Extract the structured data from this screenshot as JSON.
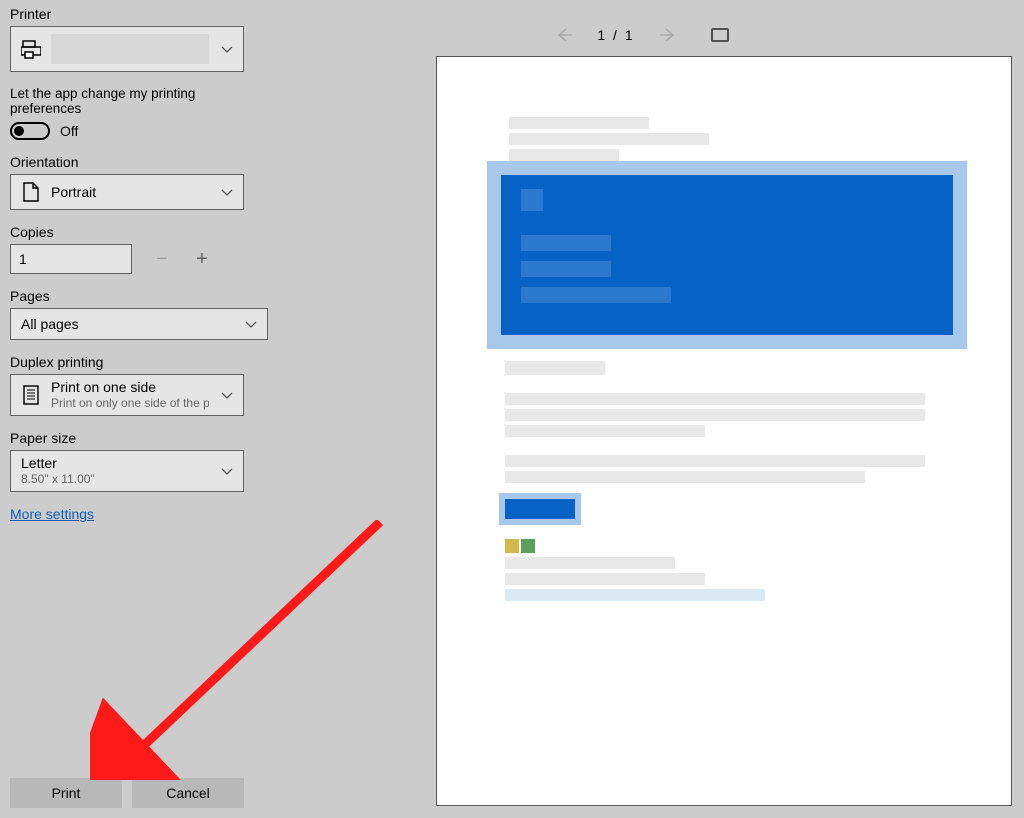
{
  "labels": {
    "printer": "Printer",
    "appPref": "Let the app change my printing preferences",
    "orientation": "Orientation",
    "copies": "Copies",
    "pages": "Pages",
    "duplex": "Duplex printing",
    "paper": "Paper size",
    "more": "More settings"
  },
  "printer": {
    "name": ""
  },
  "toggle": {
    "state": "Off"
  },
  "orientation": {
    "value": "Portrait"
  },
  "copies": {
    "value": "1"
  },
  "pages": {
    "value": "All pages"
  },
  "duplex": {
    "title": "Print on one side",
    "sub": "Print on only one side of the pa"
  },
  "paper": {
    "title": "Letter",
    "sub": "8.50\" x 11.00\""
  },
  "buttons": {
    "print": "Print",
    "cancel": "Cancel"
  },
  "preview": {
    "current": "1",
    "sep": "/",
    "total": "1"
  }
}
